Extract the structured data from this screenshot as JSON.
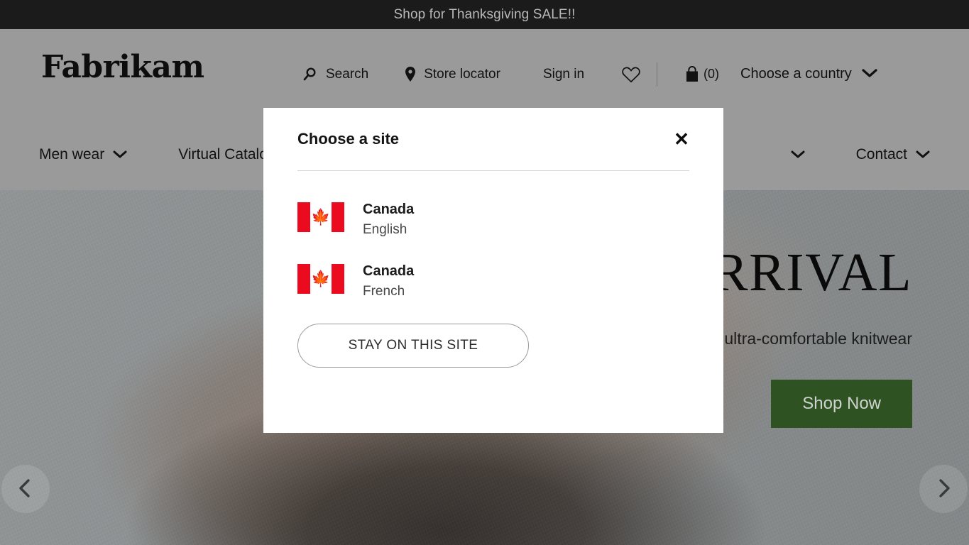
{
  "promo": {
    "text": "Shop for Thanksgiving SALE!!"
  },
  "header": {
    "logo": "Fabrikam",
    "search_label": "Search",
    "store_locator_label": "Store locator",
    "sign_in_label": "Sign in",
    "wishlist_icon": "heart-icon",
    "bag_icon": "shopping-bag-icon",
    "bag_count": "(0)",
    "country_selector_label": "Choose a country"
  },
  "nav": {
    "items": [
      {
        "label": "Men wear",
        "has_dropdown": true
      },
      {
        "label": "Virtual Catalog",
        "has_dropdown": true
      },
      {
        "label": "",
        "has_dropdown": true
      },
      {
        "label": "Contact",
        "has_dropdown": true
      }
    ]
  },
  "hero": {
    "title": "NEW ARRIVAL",
    "title_visible": "RIVAL",
    "subtitle": "Soft and ultra-comfortable knitwear",
    "subtitle_visible": "d ultra-comfortable knitwear",
    "cta_label": "Shop Now",
    "cta_color": "#2e5222",
    "prev_label": "Previous slide",
    "next_label": "Next slide"
  },
  "modal": {
    "title": "Choose a site",
    "close_label": "✕",
    "options": [
      {
        "country": "Canada",
        "language": "English",
        "flag": "canada-flag-icon"
      },
      {
        "country": "Canada",
        "language": "French",
        "flag": "canada-flag-icon"
      }
    ],
    "stay_button_label": "STAY ON THIS SITE"
  },
  "colors": {
    "banner_bg": "#1b1b1b",
    "header_bg": "#9a9a9a",
    "flag_red": "#eb0a1e",
    "cta_green": "#2e5222"
  }
}
